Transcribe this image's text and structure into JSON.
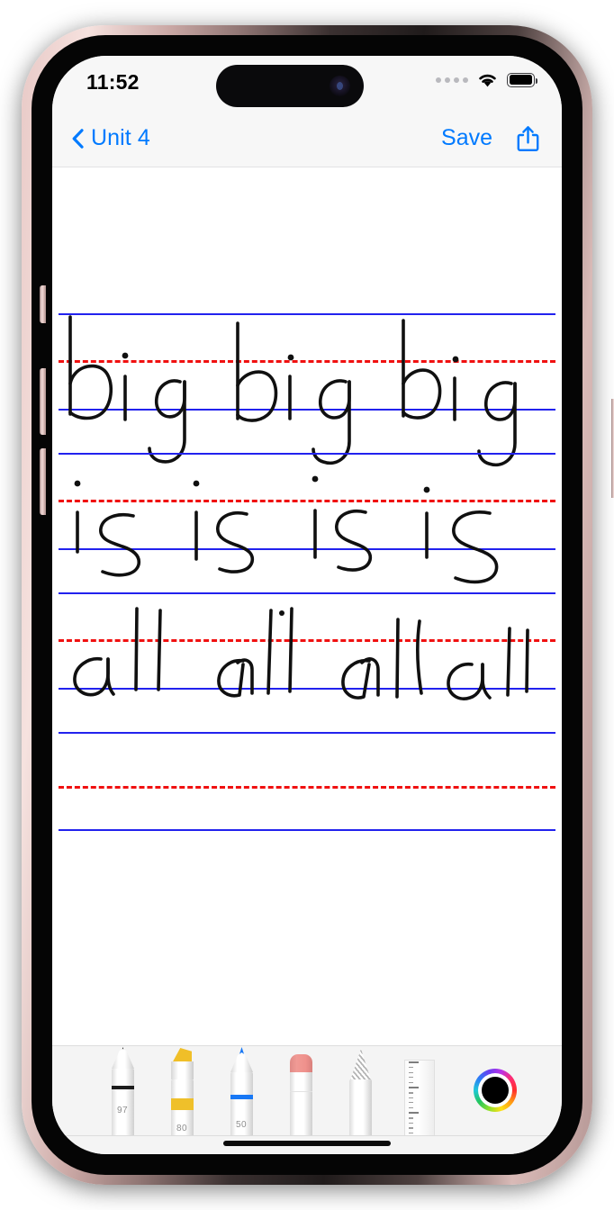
{
  "status_bar": {
    "time": "11:52",
    "signal_icon": "signal-dots-icon",
    "wifi_icon": "wifi-icon",
    "battery_icon": "battery-full-icon"
  },
  "nav_bar": {
    "back_label": "Unit 4",
    "back_icon": "chevron-left-icon",
    "save_label": "Save",
    "share_icon": "share-icon"
  },
  "canvas": {
    "description": "Handwriting practice sheet with ruled guide lines",
    "line_color_blue": "#2222ee",
    "line_color_red_dashed": "#f01010",
    "ink_color": "#101010",
    "rows": [
      {
        "index": 1,
        "written_text": "big big big",
        "repetitions": 3,
        "word": "big"
      },
      {
        "index": 2,
        "written_text": "is is is is",
        "repetitions": 4,
        "word": "is"
      },
      {
        "index": 3,
        "written_text": "all all all all",
        "repetitions": 4,
        "word": "all"
      },
      {
        "index": 4,
        "written_text": "",
        "repetitions": 0,
        "word": ""
      }
    ]
  },
  "tool_palette": {
    "tools": [
      {
        "name": "pen",
        "label": "Pen",
        "size": "97",
        "color": "#1c1c1c",
        "selected": true
      },
      {
        "name": "highlighter",
        "label": "Highlighter",
        "size": "80",
        "color": "#efc02a",
        "selected": false
      },
      {
        "name": "marker",
        "label": "Marker",
        "size": "50",
        "color": "#1878f5",
        "selected": false
      },
      {
        "name": "eraser",
        "label": "Eraser",
        "size": "",
        "color": "#ef918c",
        "selected": false
      },
      {
        "name": "pencil",
        "label": "Pencil",
        "size": "",
        "color": "#b4b4b4",
        "selected": false
      },
      {
        "name": "ruler",
        "label": "Ruler",
        "size": "",
        "color": "#e0e0e0",
        "selected": false
      }
    ],
    "color_picker": {
      "name": "color-wheel",
      "selected_color": "#000000"
    }
  },
  "home_indicator": {
    "name": "home-indicator"
  }
}
